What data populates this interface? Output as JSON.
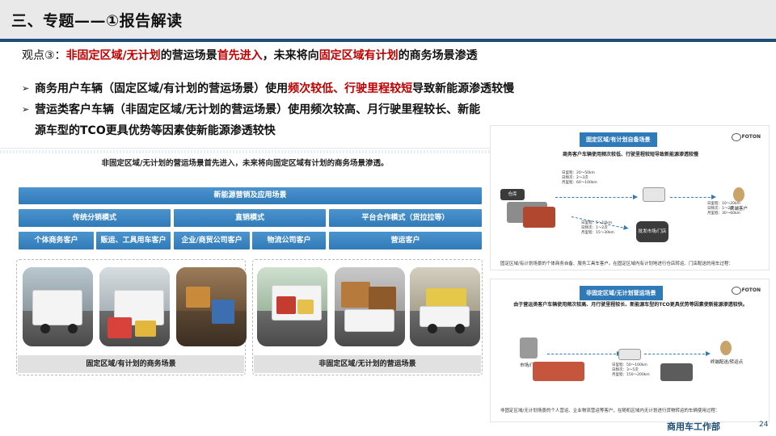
{
  "header": {
    "title": "三、专题——①报告解读"
  },
  "viewpoint": {
    "label": "观点③：",
    "seg1": "非固定区域/无计划",
    "seg2": "的营运场景",
    "seg3": "首先进入",
    "seg4": "，未来将向",
    "seg5": "固定区域有计划",
    "seg6": "的商务场景渗透"
  },
  "bullets": [
    {
      "pre": "商务用户车辆（固定区域/有计划的营运场景）使用",
      "red": "频次较低、行驶里程较短",
      "post": "导致新能源渗透较慢"
    },
    {
      "pre": "营运类客户车辆（非固定区域/无计划的营运场景）使用频次较高、月行驶里程较长、新能源车型的TCO更具优势等因素使新能源渗透较快",
      "red": "",
      "post": ""
    }
  ],
  "left_panel": {
    "title": "非固定区域/无计划的营运场景首先进入，未来将向固定区域有计划的商务场景渗透。",
    "top_bar": "新能源营销及应用场景",
    "mid_bars": [
      "传统分销模式",
      "直销模式",
      "平台合作模式（货拉拉等）"
    ],
    "low_bars": [
      "个体商务客户",
      "贩运、工具用车客户",
      "企业/商贸公司客户",
      "物流公司客户",
      "营运客户"
    ],
    "group_labels": [
      "固定区域/有计划的商务场景",
      "非固定区域/无计划的营运场景"
    ]
  },
  "right_top": {
    "tag": "固定区域/有计划自备场景",
    "brand": "FOTON",
    "subtitle": "商务客户车辆使用频次较低、行驶里程较短导致新能源渗透较慢",
    "nodes": [
      "仓库",
      "批发市场/门店",
      "终端客户"
    ],
    "specs": [
      "日里程：20～50km\n日频次：2～3次\n月里程：60～100km",
      "日里程：5～10km\n日频次：1～2次\n月里程：15～30km",
      "日里程：10～20km\n日频次：1～2次\n月里程：30～60km"
    ],
    "caption": "固定区域/有计划场景的个体商务自备、服务工具车客户。在固定区域内有计划地进行仓店转运、门店配送的用车过程："
  },
  "right_bottom": {
    "tag": "非固定区域/无计划营运场景",
    "brand": "FOTON",
    "subtitle": "由于营运类客户车辆使用频次较高、月行驶里程较长、新能源车型的TCO更具优势等因素使新能源渗透较快。",
    "nodes": [
      "市场/门店",
      "终端配送/转运点"
    ],
    "specs": [
      "日里程：50～100km\n日频次：3～5次\n月里程：150～200km"
    ],
    "caption": "非固定区域/无计划场景的个人营运、企业物流营运等客户，在随机区域内无计划进行货物转运的车辆使用过程："
  },
  "footer": {
    "dept": "商用车工作部",
    "page": "24"
  },
  "colors": {
    "accent_blue": "#2f7ab8",
    "title_navy": "#1f4e79",
    "highlight_red": "#c00000"
  }
}
